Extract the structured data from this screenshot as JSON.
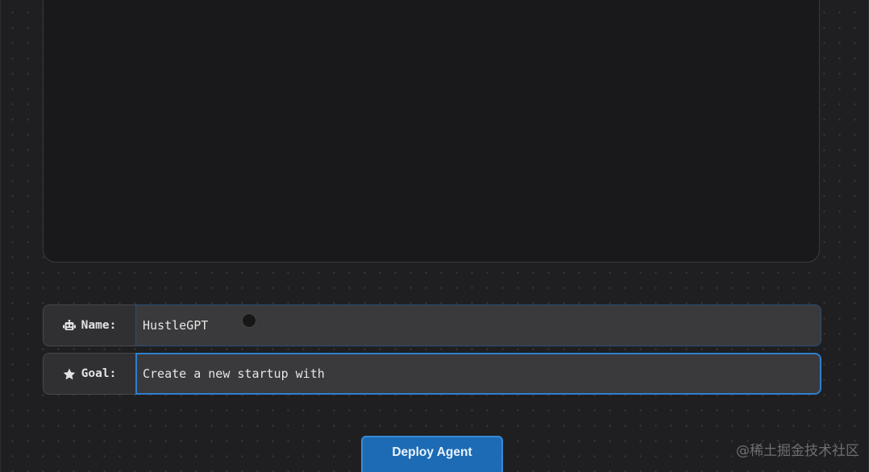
{
  "form": {
    "name_label": "Name:",
    "name_value": "HustleGPT",
    "goal_label": "Goal:",
    "goal_value": "Create a new startup with"
  },
  "actions": {
    "deploy_label": "Deploy Agent"
  },
  "watermark": "@稀土掘金技术社区",
  "colors": {
    "background": "#1f1f21",
    "panel": "#19191b",
    "accent": "#1c6bb4",
    "focus_border": "#2f7fd0"
  },
  "icons": {
    "name": "robot-icon",
    "goal": "star-icon"
  }
}
